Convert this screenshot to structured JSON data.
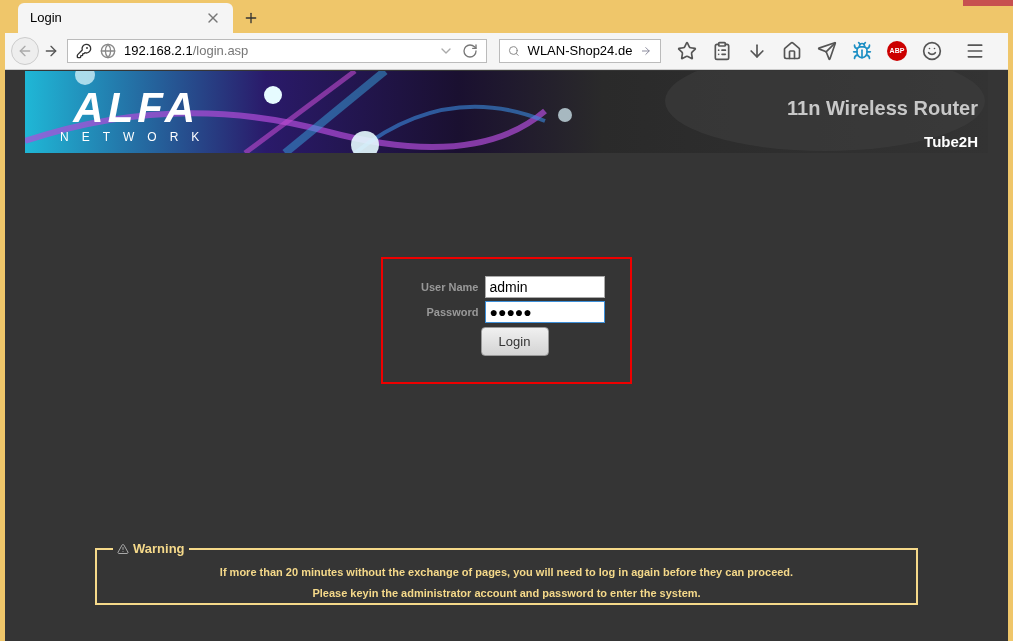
{
  "browser": {
    "tab": {
      "title": "Login",
      "selected": true
    },
    "address": {
      "host": "192.168.2.1",
      "path": "/login.asp"
    },
    "search": {
      "value": "WLAN-Shop24.de"
    },
    "adblock_badge": "ABP"
  },
  "banner": {
    "logo": "ALFA",
    "logo_sub": "NETWORK",
    "title": "11n Wireless Router",
    "model": "Tube2H"
  },
  "login": {
    "fields": [
      {
        "label": "User Name",
        "value": "admin",
        "focused": false
      },
      {
        "label": "Password",
        "value": "●●●●●",
        "focused": true
      }
    ],
    "button": "Login"
  },
  "warning": {
    "title": "Warning",
    "lines": [
      "If more than 20 minutes without the exchange of pages, you will need to log in again before they can proceed.",
      "Please keyin the administrator account and password to enter the system."
    ]
  }
}
